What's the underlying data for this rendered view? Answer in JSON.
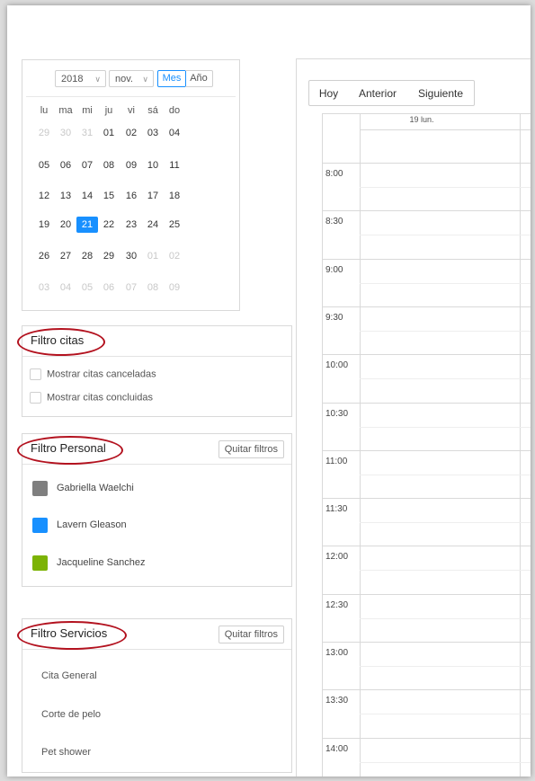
{
  "calendar": {
    "year": "2018",
    "month": "nov.",
    "view_month": "Mes",
    "view_year": "Año",
    "weekdays": [
      "lu",
      "ma",
      "mi",
      "ju",
      "vi",
      "sá",
      "do"
    ],
    "weeks": [
      [
        {
          "d": "29",
          "m": true
        },
        {
          "d": "30",
          "m": true
        },
        {
          "d": "31",
          "m": true
        },
        {
          "d": "01"
        },
        {
          "d": "02"
        },
        {
          "d": "03"
        },
        {
          "d": "04"
        }
      ],
      [
        {
          "d": "05"
        },
        {
          "d": "06"
        },
        {
          "d": "07"
        },
        {
          "d": "08"
        },
        {
          "d": "09"
        },
        {
          "d": "10"
        },
        {
          "d": "11"
        }
      ],
      [
        {
          "d": "12"
        },
        {
          "d": "13"
        },
        {
          "d": "14"
        },
        {
          "d": "15"
        },
        {
          "d": "16"
        },
        {
          "d": "17"
        },
        {
          "d": "18"
        }
      ],
      [
        {
          "d": "19"
        },
        {
          "d": "20"
        },
        {
          "d": "21",
          "s": true
        },
        {
          "d": "22"
        },
        {
          "d": "23"
        },
        {
          "d": "24"
        },
        {
          "d": "25"
        }
      ],
      [
        {
          "d": "26"
        },
        {
          "d": "27"
        },
        {
          "d": "28"
        },
        {
          "d": "29"
        },
        {
          "d": "30"
        },
        {
          "d": "01",
          "m": true
        },
        {
          "d": "02",
          "m": true
        }
      ],
      [
        {
          "d": "03",
          "m": true
        },
        {
          "d": "04",
          "m": true
        },
        {
          "d": "05",
          "m": true
        },
        {
          "d": "06",
          "m": true
        },
        {
          "d": "07",
          "m": true
        },
        {
          "d": "08",
          "m": true
        },
        {
          "d": "09",
          "m": true
        }
      ]
    ],
    "selected_color": "#1890ff"
  },
  "filtro_citas": {
    "title": "Filtro citas",
    "options": [
      "Mostrar citas canceladas",
      "Mostrar citas concluidas"
    ]
  },
  "filtro_personal": {
    "title": "Filtro Personal",
    "clear_label": "Quitar filtros",
    "staff": [
      {
        "name": "Gabriella Waelchi",
        "color": "#7f7f7f"
      },
      {
        "name": "Lavern Gleason",
        "color": "#1890ff"
      },
      {
        "name": "Jacqueline Sanchez",
        "color": "#7cb305"
      }
    ]
  },
  "filtro_servicios": {
    "title": "Filtro Servicios",
    "clear_label": "Quitar filtros",
    "services": [
      "Cita General",
      "Corte de pelo",
      "Pet shower"
    ]
  },
  "schedule": {
    "today_label": "Hoy",
    "prev_label": "Anterior",
    "next_label": "Siguiente",
    "column_header": "19 lun.",
    "times": [
      "8:00",
      "8:30",
      "9:00",
      "9:30",
      "10:00",
      "10:30",
      "11:00",
      "11:30",
      "12:00",
      "12:30",
      "13:00",
      "13:30",
      "14:00"
    ]
  },
  "highlight_color": "#b3121f"
}
